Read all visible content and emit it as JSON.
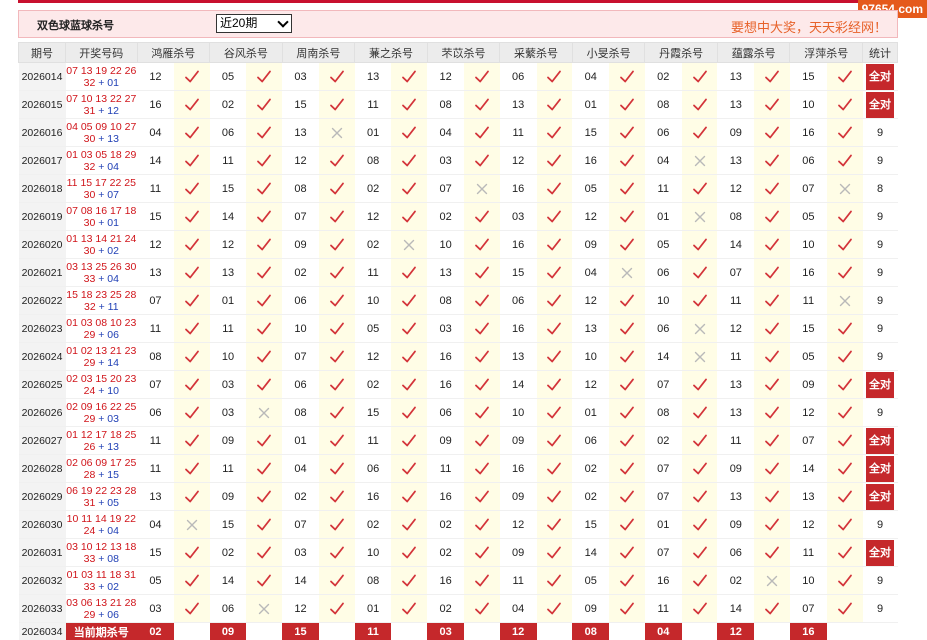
{
  "header": {
    "title": "双色球蓝球杀号",
    "period_select": "近20期",
    "slogan": "要想中大奖，天天彩经网！",
    "watermark": "97654.com"
  },
  "columns": [
    "期号",
    "开奖号码",
    "鸿雁杀号",
    "谷风杀号",
    "周南杀号",
    "蒹之杀号",
    "芣苡杀号",
    "采蘩杀号",
    "小旻杀号",
    "丹霞杀号",
    "蕴露杀号",
    "浮萍杀号",
    "统计"
  ],
  "rows": [
    {
      "issue": "2026014",
      "line1": "07 13 19 22 26",
      "red2": "32",
      "blue": "01",
      "kills": [
        "12",
        "05",
        "03",
        "13",
        "12",
        "06",
        "04",
        "02",
        "13",
        "15"
      ],
      "marks": [
        1,
        1,
        1,
        1,
        1,
        1,
        1,
        1,
        1,
        1
      ],
      "stat": "全对"
    },
    {
      "issue": "2026015",
      "line1": "07 10 13 22 27",
      "red2": "31",
      "blue": "12",
      "kills": [
        "16",
        "02",
        "15",
        "11",
        "08",
        "13",
        "01",
        "08",
        "13",
        "10"
      ],
      "marks": [
        1,
        1,
        1,
        1,
        1,
        1,
        1,
        1,
        1,
        1
      ],
      "stat": "全对"
    },
    {
      "issue": "2026016",
      "line1": "04 05 09 10 27",
      "red2": "30",
      "blue": "13",
      "kills": [
        "04",
        "06",
        "13",
        "01",
        "04",
        "11",
        "15",
        "06",
        "09",
        "16"
      ],
      "marks": [
        1,
        1,
        0,
        1,
        1,
        1,
        1,
        1,
        1,
        1
      ],
      "stat": "9"
    },
    {
      "issue": "2026017",
      "line1": "01 03 05 18 29",
      "red2": "32",
      "blue": "04",
      "kills": [
        "14",
        "11",
        "12",
        "08",
        "03",
        "12",
        "16",
        "04",
        "13",
        "06"
      ],
      "marks": [
        1,
        1,
        1,
        1,
        1,
        1,
        1,
        0,
        1,
        1
      ],
      "stat": "9"
    },
    {
      "issue": "2026018",
      "line1": "11 15 17 22 25",
      "red2": "30",
      "blue": "07",
      "kills": [
        "11",
        "15",
        "08",
        "02",
        "07",
        "16",
        "05",
        "11",
        "12",
        "07"
      ],
      "marks": [
        1,
        1,
        1,
        1,
        0,
        1,
        1,
        1,
        1,
        0
      ],
      "stat": "8"
    },
    {
      "issue": "2026019",
      "line1": "07 08 16 17 18",
      "red2": "30",
      "blue": "01",
      "kills": [
        "15",
        "14",
        "07",
        "12",
        "02",
        "03",
        "12",
        "01",
        "08",
        "05"
      ],
      "marks": [
        1,
        1,
        1,
        1,
        1,
        1,
        1,
        0,
        1,
        1
      ],
      "stat": "9"
    },
    {
      "issue": "2026020",
      "line1": "01 13 14 21 24",
      "red2": "30",
      "blue": "02",
      "kills": [
        "12",
        "12",
        "09",
        "02",
        "10",
        "16",
        "09",
        "05",
        "14",
        "10"
      ],
      "marks": [
        1,
        1,
        1,
        0,
        1,
        1,
        1,
        1,
        1,
        1
      ],
      "stat": "9"
    },
    {
      "issue": "2026021",
      "line1": "03 13 25 26 30",
      "red2": "33",
      "blue": "04",
      "kills": [
        "13",
        "13",
        "02",
        "11",
        "13",
        "15",
        "04",
        "06",
        "07",
        "16"
      ],
      "marks": [
        1,
        1,
        1,
        1,
        1,
        1,
        0,
        1,
        1,
        1
      ],
      "stat": "9"
    },
    {
      "issue": "2026022",
      "line1": "15 18 23 25 28",
      "red2": "32",
      "blue": "11",
      "kills": [
        "07",
        "01",
        "06",
        "10",
        "08",
        "06",
        "12",
        "10",
        "11",
        "11"
      ],
      "marks": [
        1,
        1,
        1,
        1,
        1,
        1,
        1,
        1,
        1,
        0
      ],
      "stat": "9"
    },
    {
      "issue": "2026023",
      "line1": "01 03 08 10 23",
      "red2": "29",
      "blue": "06",
      "kills": [
        "11",
        "11",
        "10",
        "05",
        "03",
        "16",
        "13",
        "06",
        "12",
        "15"
      ],
      "marks": [
        1,
        1,
        1,
        1,
        1,
        1,
        1,
        0,
        1,
        1
      ],
      "stat": "9"
    },
    {
      "issue": "2026024",
      "line1": "01 02 13 21 23",
      "red2": "29",
      "blue": "14",
      "kills": [
        "08",
        "10",
        "07",
        "12",
        "16",
        "13",
        "10",
        "14",
        "11",
        "05"
      ],
      "marks": [
        1,
        1,
        1,
        1,
        1,
        1,
        1,
        0,
        1,
        1
      ],
      "stat": "9"
    },
    {
      "issue": "2026025",
      "line1": "02 03 15 20 23",
      "red2": "24",
      "blue": "10",
      "kills": [
        "07",
        "03",
        "06",
        "02",
        "16",
        "14",
        "12",
        "07",
        "13",
        "09"
      ],
      "marks": [
        1,
        1,
        1,
        1,
        1,
        1,
        1,
        1,
        1,
        1
      ],
      "stat": "全对"
    },
    {
      "issue": "2026026",
      "line1": "02 09 16 22 25",
      "red2": "29",
      "blue": "03",
      "kills": [
        "06",
        "03",
        "08",
        "15",
        "06",
        "10",
        "01",
        "08",
        "13",
        "12"
      ],
      "marks": [
        1,
        0,
        1,
        1,
        1,
        1,
        1,
        1,
        1,
        1
      ],
      "stat": "9"
    },
    {
      "issue": "2026027",
      "line1": "01 12 17 18 25",
      "red2": "26",
      "blue": "13",
      "kills": [
        "11",
        "09",
        "01",
        "11",
        "09",
        "09",
        "06",
        "02",
        "11",
        "07"
      ],
      "marks": [
        1,
        1,
        1,
        1,
        1,
        1,
        1,
        1,
        1,
        1
      ],
      "stat": "全对"
    },
    {
      "issue": "2026028",
      "line1": "02 06 09 17 25",
      "red2": "28",
      "blue": "15",
      "kills": [
        "11",
        "11",
        "04",
        "06",
        "11",
        "16",
        "02",
        "07",
        "09",
        "14"
      ],
      "marks": [
        1,
        1,
        1,
        1,
        1,
        1,
        1,
        1,
        1,
        1
      ],
      "stat": "全对"
    },
    {
      "issue": "2026029",
      "line1": "06 19 22 23 28",
      "red2": "31",
      "blue": "05",
      "kills": [
        "13",
        "09",
        "02",
        "16",
        "16",
        "09",
        "02",
        "07",
        "13",
        "13"
      ],
      "marks": [
        1,
        1,
        1,
        1,
        1,
        1,
        1,
        1,
        1,
        1
      ],
      "stat": "全对"
    },
    {
      "issue": "2026030",
      "line1": "10 11 14 19 22",
      "red2": "24",
      "blue": "04",
      "kills": [
        "04",
        "15",
        "07",
        "02",
        "02",
        "12",
        "15",
        "01",
        "09",
        "12"
      ],
      "marks": [
        0,
        1,
        1,
        1,
        1,
        1,
        1,
        1,
        1,
        1
      ],
      "stat": "9"
    },
    {
      "issue": "2026031",
      "line1": "03 10 12 13 18",
      "red2": "33",
      "blue": "08",
      "kills": [
        "15",
        "02",
        "03",
        "10",
        "02",
        "09",
        "14",
        "07",
        "06",
        "11"
      ],
      "marks": [
        1,
        1,
        1,
        1,
        1,
        1,
        1,
        1,
        1,
        1
      ],
      "stat": "全对"
    },
    {
      "issue": "2026032",
      "line1": "01 03 11 18 31",
      "red2": "33",
      "blue": "02",
      "kills": [
        "05",
        "14",
        "14",
        "08",
        "16",
        "11",
        "05",
        "16",
        "02",
        "10"
      ],
      "marks": [
        1,
        1,
        1,
        1,
        1,
        1,
        1,
        1,
        0,
        1
      ],
      "stat": "9"
    },
    {
      "issue": "2026033",
      "line1": "03 06 13 21 28",
      "red2": "29",
      "blue": "06",
      "kills": [
        "03",
        "06",
        "12",
        "01",
        "02",
        "04",
        "09",
        "11",
        "14",
        "07"
      ],
      "marks": [
        1,
        0,
        1,
        1,
        1,
        1,
        1,
        1,
        1,
        1
      ],
      "stat": "9"
    }
  ],
  "current": {
    "issue": "2026034",
    "label": "当前期杀号",
    "kills": [
      "02",
      "09",
      "15",
      "11",
      "03",
      "12",
      "08",
      "04",
      "12",
      "16"
    ]
  }
}
